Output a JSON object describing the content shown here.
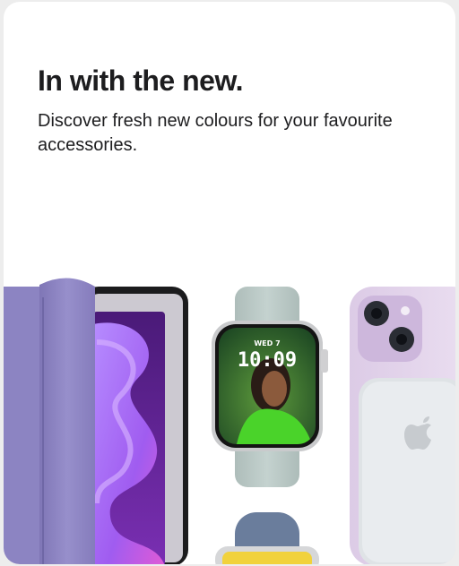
{
  "card": {
    "headline": "In with the new.",
    "description": "Discover fresh new colours for your favourite accessories."
  },
  "watch": {
    "day": "WED 7",
    "time": "10:09"
  },
  "colors": {
    "text": "#1d1d1f",
    "ipad_cover": "#8f86c4",
    "watch_band": "#b9c7c4",
    "iphone_case": "#e4d6ec",
    "battery_pack": "#e9ecef",
    "band_blue": "#6a7d9c",
    "band_yellow": "#f1d23c"
  },
  "icons": [
    "apple-logo-icon",
    "camera-lens-icon"
  ]
}
